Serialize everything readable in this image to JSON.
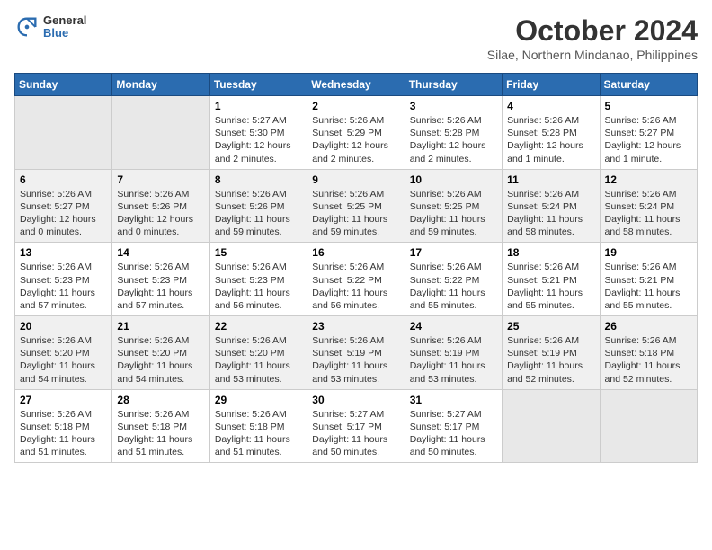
{
  "header": {
    "logo_general": "General",
    "logo_blue": "Blue",
    "month": "October 2024",
    "location": "Silae, Northern Mindanao, Philippines"
  },
  "days_of_week": [
    "Sunday",
    "Monday",
    "Tuesday",
    "Wednesday",
    "Thursday",
    "Friday",
    "Saturday"
  ],
  "weeks": [
    [
      {
        "day": "",
        "empty": true
      },
      {
        "day": "",
        "empty": true
      },
      {
        "day": "1",
        "sunrise": "5:27 AM",
        "sunset": "5:30 PM",
        "daylight": "12 hours and 2 minutes."
      },
      {
        "day": "2",
        "sunrise": "5:26 AM",
        "sunset": "5:29 PM",
        "daylight": "12 hours and 2 minutes."
      },
      {
        "day": "3",
        "sunrise": "5:26 AM",
        "sunset": "5:28 PM",
        "daylight": "12 hours and 2 minutes."
      },
      {
        "day": "4",
        "sunrise": "5:26 AM",
        "sunset": "5:28 PM",
        "daylight": "12 hours and 1 minute."
      },
      {
        "day": "5",
        "sunrise": "5:26 AM",
        "sunset": "5:27 PM",
        "daylight": "12 hours and 1 minute."
      }
    ],
    [
      {
        "day": "6",
        "sunrise": "5:26 AM",
        "sunset": "5:27 PM",
        "daylight": "12 hours and 0 minutes."
      },
      {
        "day": "7",
        "sunrise": "5:26 AM",
        "sunset": "5:26 PM",
        "daylight": "12 hours and 0 minutes."
      },
      {
        "day": "8",
        "sunrise": "5:26 AM",
        "sunset": "5:26 PM",
        "daylight": "11 hours and 59 minutes."
      },
      {
        "day": "9",
        "sunrise": "5:26 AM",
        "sunset": "5:25 PM",
        "daylight": "11 hours and 59 minutes."
      },
      {
        "day": "10",
        "sunrise": "5:26 AM",
        "sunset": "5:25 PM",
        "daylight": "11 hours and 59 minutes."
      },
      {
        "day": "11",
        "sunrise": "5:26 AM",
        "sunset": "5:24 PM",
        "daylight": "11 hours and 58 minutes."
      },
      {
        "day": "12",
        "sunrise": "5:26 AM",
        "sunset": "5:24 PM",
        "daylight": "11 hours and 58 minutes."
      }
    ],
    [
      {
        "day": "13",
        "sunrise": "5:26 AM",
        "sunset": "5:23 PM",
        "daylight": "11 hours and 57 minutes."
      },
      {
        "day": "14",
        "sunrise": "5:26 AM",
        "sunset": "5:23 PM",
        "daylight": "11 hours and 57 minutes."
      },
      {
        "day": "15",
        "sunrise": "5:26 AM",
        "sunset": "5:23 PM",
        "daylight": "11 hours and 56 minutes."
      },
      {
        "day": "16",
        "sunrise": "5:26 AM",
        "sunset": "5:22 PM",
        "daylight": "11 hours and 56 minutes."
      },
      {
        "day": "17",
        "sunrise": "5:26 AM",
        "sunset": "5:22 PM",
        "daylight": "11 hours and 55 minutes."
      },
      {
        "day": "18",
        "sunrise": "5:26 AM",
        "sunset": "5:21 PM",
        "daylight": "11 hours and 55 minutes."
      },
      {
        "day": "19",
        "sunrise": "5:26 AM",
        "sunset": "5:21 PM",
        "daylight": "11 hours and 55 minutes."
      }
    ],
    [
      {
        "day": "20",
        "sunrise": "5:26 AM",
        "sunset": "5:20 PM",
        "daylight": "11 hours and 54 minutes."
      },
      {
        "day": "21",
        "sunrise": "5:26 AM",
        "sunset": "5:20 PM",
        "daylight": "11 hours and 54 minutes."
      },
      {
        "day": "22",
        "sunrise": "5:26 AM",
        "sunset": "5:20 PM",
        "daylight": "11 hours and 53 minutes."
      },
      {
        "day": "23",
        "sunrise": "5:26 AM",
        "sunset": "5:19 PM",
        "daylight": "11 hours and 53 minutes."
      },
      {
        "day": "24",
        "sunrise": "5:26 AM",
        "sunset": "5:19 PM",
        "daylight": "11 hours and 53 minutes."
      },
      {
        "day": "25",
        "sunrise": "5:26 AM",
        "sunset": "5:19 PM",
        "daylight": "11 hours and 52 minutes."
      },
      {
        "day": "26",
        "sunrise": "5:26 AM",
        "sunset": "5:18 PM",
        "daylight": "11 hours and 52 minutes."
      }
    ],
    [
      {
        "day": "27",
        "sunrise": "5:26 AM",
        "sunset": "5:18 PM",
        "daylight": "11 hours and 51 minutes."
      },
      {
        "day": "28",
        "sunrise": "5:26 AM",
        "sunset": "5:18 PM",
        "daylight": "11 hours and 51 minutes."
      },
      {
        "day": "29",
        "sunrise": "5:26 AM",
        "sunset": "5:18 PM",
        "daylight": "11 hours and 51 minutes."
      },
      {
        "day": "30",
        "sunrise": "5:27 AM",
        "sunset": "5:17 PM",
        "daylight": "11 hours and 50 minutes."
      },
      {
        "day": "31",
        "sunrise": "5:27 AM",
        "sunset": "5:17 PM",
        "daylight": "11 hours and 50 minutes."
      },
      {
        "day": "",
        "empty": true
      },
      {
        "day": "",
        "empty": true
      }
    ]
  ],
  "labels": {
    "sunrise_prefix": "Sunrise: ",
    "sunset_prefix": "Sunset: ",
    "daylight_prefix": "Daylight: "
  }
}
